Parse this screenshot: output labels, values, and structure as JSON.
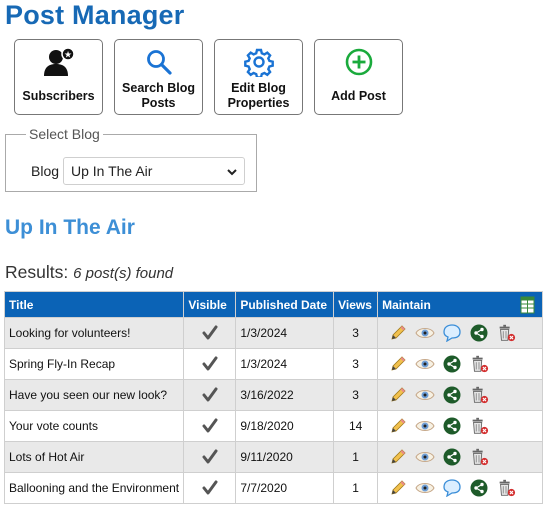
{
  "header": {
    "title": "Post Manager"
  },
  "toolbar": {
    "subscribers": "Subscribers",
    "search": "Search Blog Posts",
    "edit": "Edit Blog Properties",
    "add": "Add Post"
  },
  "select_blog": {
    "legend": "Select Blog",
    "label": "Blog",
    "selected": "Up In The Air"
  },
  "blog_heading": "Up In The Air",
  "results": {
    "label": "Results:",
    "found": "6 post(s) found"
  },
  "table": {
    "headers": {
      "title": "Title",
      "visible": "Visible",
      "published": "Published Date",
      "views": "Views",
      "maintain": "Maintain"
    },
    "rows": [
      {
        "title": "Looking for volunteers!",
        "date": "1/3/2024",
        "views": "3",
        "comments": true
      },
      {
        "title": "Spring Fly-In Recap",
        "date": "1/3/2024",
        "views": "3",
        "comments": false
      },
      {
        "title": "Have you seen our new look?",
        "date": "3/16/2022",
        "views": "3",
        "comments": false
      },
      {
        "title": "Your vote counts",
        "date": "9/18/2020",
        "views": "14",
        "comments": false
      },
      {
        "title": "Lots of Hot Air",
        "date": "9/11/2020",
        "views": "1",
        "comments": false
      },
      {
        "title": "Ballooning and the Environment",
        "date": "7/7/2020",
        "views": "1",
        "comments": true
      }
    ]
  },
  "colors": {
    "title_blue": "#1769b5",
    "header_blue": "#0b63b6",
    "heading_blue": "#3d8fd6",
    "add_green": "#1aaa3c"
  },
  "icons": {
    "subscribers": "user-star-icon",
    "search": "magnifier-icon",
    "edit": "gear-icon",
    "add": "plus-circle-icon",
    "export": "spreadsheet-export-icon",
    "visible": "checkmark-icon",
    "edit_post": "pencil-icon",
    "view": "eye-icon",
    "comments": "speech-bubble-icon",
    "share": "share-icon",
    "delete": "trash-icon"
  }
}
